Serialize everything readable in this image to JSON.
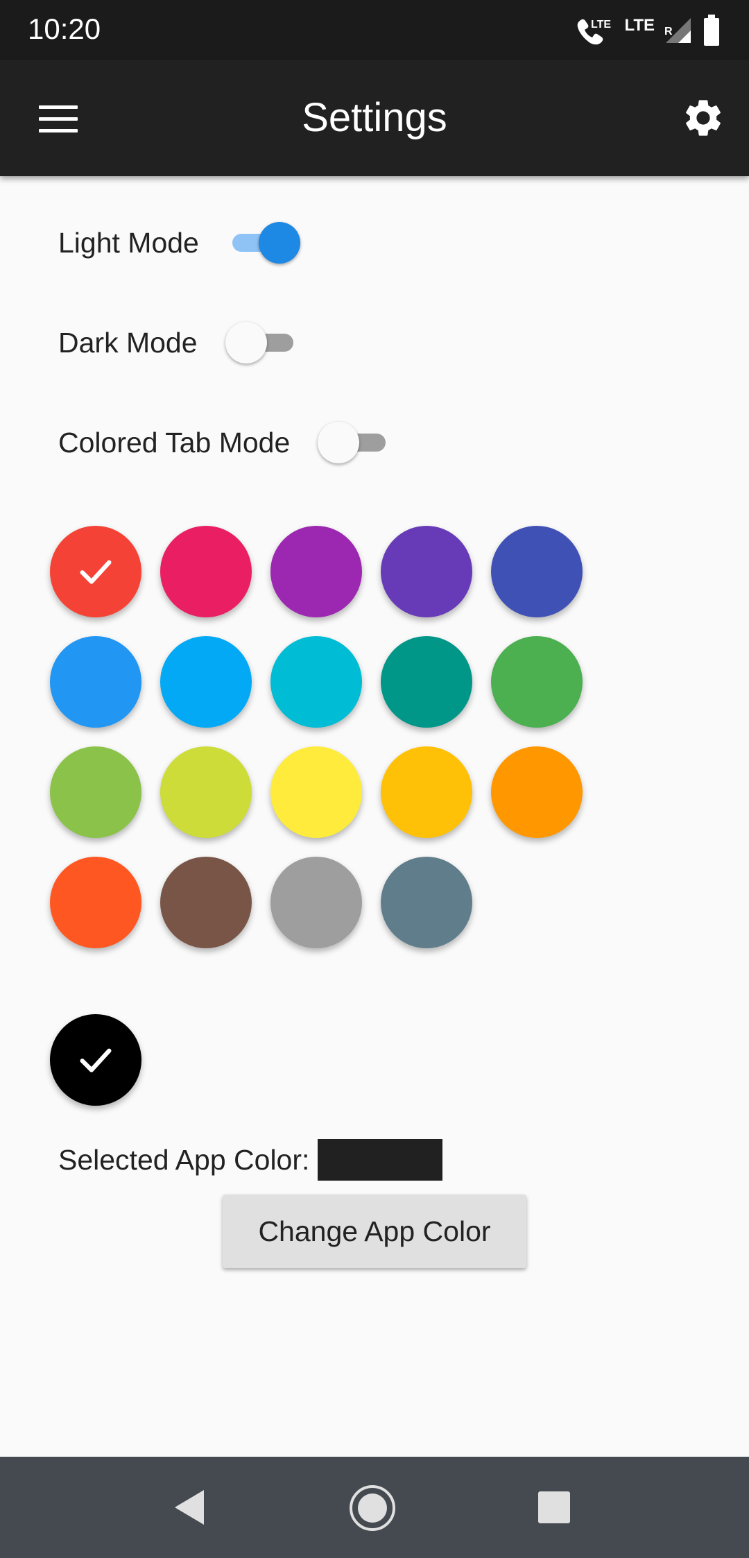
{
  "status_bar": {
    "time": "10:20",
    "icons": [
      "phone-lte-icon",
      "lte-icon",
      "signal-roaming-icon",
      "battery-icon"
    ],
    "lte_label_1": "LTE",
    "lte_label_2": "LTE",
    "roaming_label": "R"
  },
  "app_bar": {
    "title": "Settings",
    "menu_icon": "hamburger-menu-icon",
    "action_icon": "gear-icon"
  },
  "toggles": [
    {
      "label": "Light Mode",
      "on": true
    },
    {
      "label": "Dark Mode",
      "on": false
    },
    {
      "label": "Colored Tab Mode",
      "on": false
    }
  ],
  "color_swatches": [
    {
      "color": "#f44336",
      "selected": true
    },
    {
      "color": "#e91e63",
      "selected": false
    },
    {
      "color": "#9c27b0",
      "selected": false
    },
    {
      "color": "#673ab7",
      "selected": false
    },
    {
      "color": "#3f51b5",
      "selected": false
    },
    {
      "color": "#2196f3",
      "selected": false
    },
    {
      "color": "#03a9f4",
      "selected": false
    },
    {
      "color": "#00bcd4",
      "selected": false
    },
    {
      "color": "#009688",
      "selected": false
    },
    {
      "color": "#4caf50",
      "selected": false
    },
    {
      "color": "#8bc34a",
      "selected": false
    },
    {
      "color": "#cddc39",
      "selected": false
    },
    {
      "color": "#ffeb3b",
      "selected": false
    },
    {
      "color": "#ffc107",
      "selected": false
    },
    {
      "color": "#ff9800",
      "selected": false
    },
    {
      "color": "#ff5722",
      "selected": false
    },
    {
      "color": "#795548",
      "selected": false
    },
    {
      "color": "#9e9e9e",
      "selected": false
    },
    {
      "color": "#607d8b",
      "selected": false
    }
  ],
  "shade_swatch": {
    "color": "#000000",
    "selected": true
  },
  "selected_color": {
    "label": "Selected App Color:",
    "value": "#212121"
  },
  "change_button": {
    "label": "Change App Color"
  },
  "nav_bar": {
    "icons": [
      "back-icon",
      "home-icon",
      "recents-icon"
    ]
  }
}
